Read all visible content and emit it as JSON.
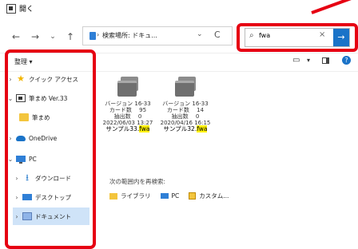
{
  "window": {
    "title": "開く"
  },
  "nav": {
    "back": "←",
    "forward": "→",
    "history": "⌄",
    "up": "↑",
    "address_text": "検索場所: ドキュ...",
    "address_sep": "›",
    "refresh": "C",
    "search": {
      "value": "fwa",
      "clear": "×",
      "go": "→",
      "icon": "search-icon"
    }
  },
  "toolbar": {
    "organize": "整理 ▾",
    "help": "?"
  },
  "sidebar": {
    "items": [
      {
        "label": "クイック アクセス",
        "chev": "›",
        "icon": "star"
      },
      {
        "label": "筆まめ Ver.33",
        "chev": "⌄",
        "icon": "app"
      },
      {
        "label": "筆まめ",
        "chev": "",
        "icon": "folder"
      },
      {
        "label": "OneDrive",
        "chev": "›",
        "icon": "cloud"
      },
      {
        "label": "PC",
        "chev": "⌄",
        "icon": "pc"
      },
      {
        "label": "ダウンロード",
        "chev": "›",
        "icon": "download"
      },
      {
        "label": "デスクトップ",
        "chev": "›",
        "icon": "desktop"
      },
      {
        "label": "ドキュメント",
        "chev": "›",
        "icon": "documents",
        "selected": true
      }
    ]
  },
  "files": [
    {
      "version": "バージョン 16-33",
      "cards": "カード数　 95",
      "extracted": "抽出数　 0",
      "date": "2022/06/03 13:27",
      "name_prefix": "サンプル33.",
      "name_ext": "fwa"
    },
    {
      "version": "バージョン 16-33",
      "cards": "カード数　 14",
      "extracted": "抽出数　 0",
      "date": "2020/04/16 16:15",
      "name_prefix": "サンプル32.",
      "name_ext": "fwa"
    }
  ],
  "search_again": {
    "label": "次の範囲内を再検索:",
    "scopes": [
      "ライブラリ",
      "PC",
      "カスタム..."
    ]
  },
  "colors": {
    "highlight": "#e60012",
    "accent": "#1a73c8",
    "match": "#fff200"
  }
}
